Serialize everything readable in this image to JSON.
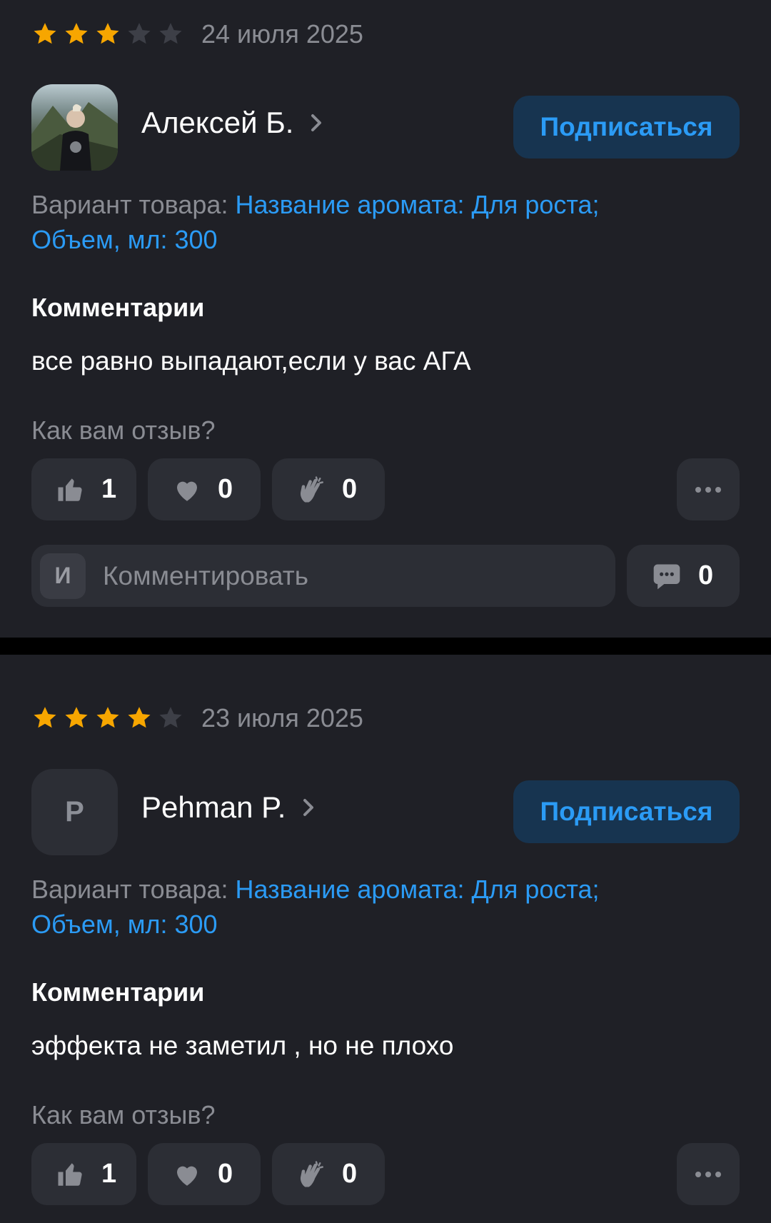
{
  "reviews": [
    {
      "rating": 3,
      "max_rating": 5,
      "date": "24 июля 2025",
      "author": "Алексей Б.",
      "avatar_type": "photo",
      "subscribe_label": "Подписаться",
      "variant_label": "Вариант товара: ",
      "variant_value_line1": "Название аромата: Для роста;",
      "variant_value_line2": "Объем, мл: 300",
      "comments_heading": "Комментарии",
      "comment": "все равно выпадают,если у вас АГА",
      "question": "Как вам отзыв?",
      "likes": "1",
      "hearts": "0",
      "claps": "0",
      "comment_input_avatar": "И",
      "comment_placeholder": "Комментировать",
      "comments_count": "0"
    },
    {
      "rating": 4,
      "max_rating": 5,
      "date": "23 июля 2025",
      "author": "Pehman P.",
      "avatar_letter": "P",
      "subscribe_label": "Подписаться",
      "variant_label": "Вариант товара: ",
      "variant_value_line1": "Название аромата: Для роста;",
      "variant_value_line2": "Объем, мл: 300",
      "comments_heading": "Комментарии",
      "comment": "эффекта не заметил , но не плохо",
      "question": "Как вам отзыв?",
      "likes": "1",
      "hearts": "0",
      "claps": "0"
    }
  ],
  "colors": {
    "background": "#1f2026",
    "separator": "#000000",
    "star_on": "#f7a600",
    "star_off": "#3d3f47",
    "accent": "#2b9bf5",
    "button_bg": "#2c2e35",
    "subscribe_bg": "#173450",
    "muted_text": "#8a8c93"
  },
  "icons": {
    "star": "star-icon",
    "chevron": "chevron-right-icon",
    "like": "thumbs-up-icon",
    "heart": "heart-icon",
    "clap": "clapping-hands-icon",
    "more": "more-dots-icon",
    "comments": "speech-bubble-icon"
  }
}
